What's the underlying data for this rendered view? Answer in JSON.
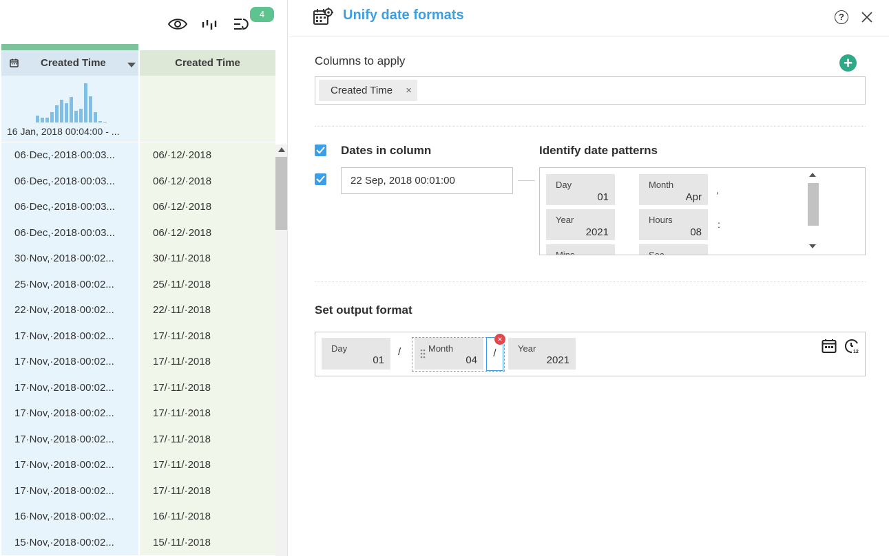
{
  "toolbar": {
    "eye_icon": "eye-icon",
    "chart_icon": "column-stats-icon",
    "rules_icon": "applied-steps-icon",
    "rules_count": "4"
  },
  "grid": {
    "columns": [
      {
        "label": "Created Time",
        "type_icon": "calendar-icon"
      },
      {
        "label": "Created Time"
      }
    ],
    "histogram_caption": "16 Jan, 2018 00:04:00 - ...",
    "rows": [
      {
        "original": "06·Dec,·2018·00:03...",
        "unified": "06/·12/·2018"
      },
      {
        "original": "06·Dec,·2018·00:03...",
        "unified": "06/·12/·2018"
      },
      {
        "original": "06·Dec,·2018·00:03...",
        "unified": "06/·12/·2018"
      },
      {
        "original": "06·Dec,·2018·00:03...",
        "unified": "06/·12/·2018"
      },
      {
        "original": "30·Nov,·2018·00:02...",
        "unified": "30/·11/·2018"
      },
      {
        "original": "25·Nov,·2018·00:02...",
        "unified": "25/·11/·2018"
      },
      {
        "original": "22·Nov,·2018·00:02...",
        "unified": "22/·11/·2018"
      },
      {
        "original": "17·Nov,·2018·00:02...",
        "unified": "17/·11/·2018"
      },
      {
        "original": "17·Nov,·2018·00:02...",
        "unified": "17/·11/·2018"
      },
      {
        "original": "17·Nov,·2018·00:02...",
        "unified": "17/·11/·2018"
      },
      {
        "original": "17·Nov,·2018·00:02...",
        "unified": "17/·11/·2018"
      },
      {
        "original": "17·Nov,·2018·00:02...",
        "unified": "17/·11/·2018"
      },
      {
        "original": "17·Nov,·2018·00:02...",
        "unified": "17/·11/·2018"
      },
      {
        "original": "17·Nov,·2018·00:02...",
        "unified": "17/·11/·2018"
      },
      {
        "original": "16·Nov,·2018·00:02...",
        "unified": "16/·11/·2018"
      },
      {
        "original": "15·Nov,·2018·00:02...",
        "unified": "15/·11/·2018"
      }
    ]
  },
  "panel": {
    "title": "Unify date formats",
    "help_label": "?",
    "columns_to_apply": {
      "label": "Columns to apply",
      "add_label": "+",
      "chips": [
        {
          "label": "Created Time",
          "remove": "×"
        }
      ]
    },
    "dates_in_column": {
      "label": "Dates in column",
      "checked": true,
      "sample_value": "22 Sep, 2018 00:01:00",
      "sample_checked": true
    },
    "identify_patterns": {
      "label": "Identify date patterns",
      "tiles": [
        {
          "name": "Day",
          "value": "01"
        },
        {
          "name": "Month",
          "value": "Apr"
        },
        {
          "name": "Year",
          "value": "2021"
        },
        {
          "name": "Hours",
          "value": "08"
        },
        {
          "name": "Mins",
          "value": ""
        },
        {
          "name": "Sec",
          "value": ""
        }
      ],
      "separators": [
        ",",
        ":"
      ]
    },
    "output_format": {
      "label": "Set output format",
      "tiles": [
        {
          "name": "Day",
          "value": "01"
        },
        {
          "name": "Month",
          "value": "04"
        },
        {
          "name": "Year",
          "value": "2021"
        }
      ],
      "separators": [
        "/",
        "/"
      ],
      "remove_label": "×"
    }
  },
  "colors": {
    "accent": "#3f9ee0",
    "add_button": "#2faa88",
    "badge": "#5ec38e",
    "remove": "#e2474d",
    "col1_bg": "#e8f4fc",
    "col2_bg": "#f1f6ea"
  }
}
